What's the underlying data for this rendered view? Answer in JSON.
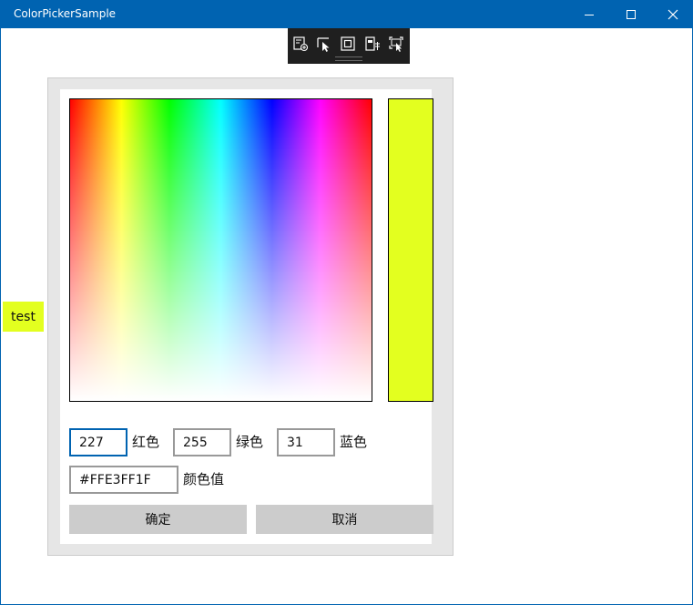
{
  "window": {
    "title": "ColorPickerSample",
    "titlebar_color": "#0063b1"
  },
  "caption_buttons": {
    "minimize_icon": "minimize-icon",
    "maximize_icon": "maximize-icon",
    "close_icon": "close-icon"
  },
  "devtools_toolbar": {
    "items": [
      "live-visual-tree-icon",
      "select-element-icon",
      "display-layout-adorners-icon",
      "track-focus-icon",
      "preview-selection-icon"
    ]
  },
  "side_button": {
    "label": "test",
    "color": "#e3ff1f"
  },
  "color_picker": {
    "preview_color": "#e3ff1f",
    "red": {
      "value": "227",
      "label": "红色"
    },
    "green": {
      "value": "255",
      "label": "绿色"
    },
    "blue": {
      "value": "31",
      "label": "蓝色"
    },
    "hex": {
      "value": "#FFE3FF1F",
      "label": "颜色值"
    },
    "ok_label": "确定",
    "cancel_label": "取消"
  }
}
